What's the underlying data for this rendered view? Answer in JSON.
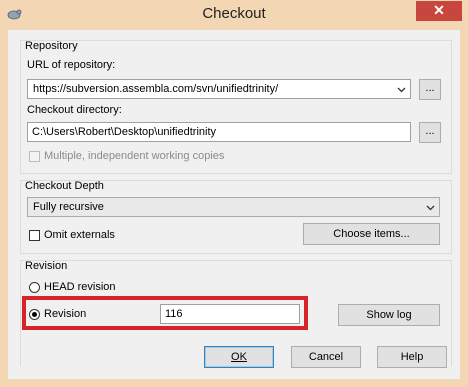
{
  "window": {
    "title": "Checkout",
    "close_glyph": "✕",
    "accent_close": "#c7463e",
    "highlight_color": "#d8232a"
  },
  "repository": {
    "group_label": "Repository",
    "url_label": "URL of repository:",
    "url_value": "https://subversion.assembla.com/svn/unifiedtrinity/",
    "browse_label": "...",
    "dir_label": "Checkout directory:",
    "dir_value": "C:\\Users\\Robert\\Desktop\\unifiedtrinity",
    "dir_browse_label": "...",
    "multiple_label": "Multiple, independent working copies"
  },
  "depth": {
    "group_label": "Checkout Depth",
    "selected": "Fully recursive",
    "omit_label": "Omit externals",
    "choose_label": "Choose items..."
  },
  "revision": {
    "group_label": "Revision",
    "head_label": "HEAD revision",
    "rev_label": "Revision",
    "rev_value": "116",
    "show_log_label": "Show log"
  },
  "buttons": {
    "ok": "OK",
    "cancel": "Cancel",
    "help": "Help"
  }
}
